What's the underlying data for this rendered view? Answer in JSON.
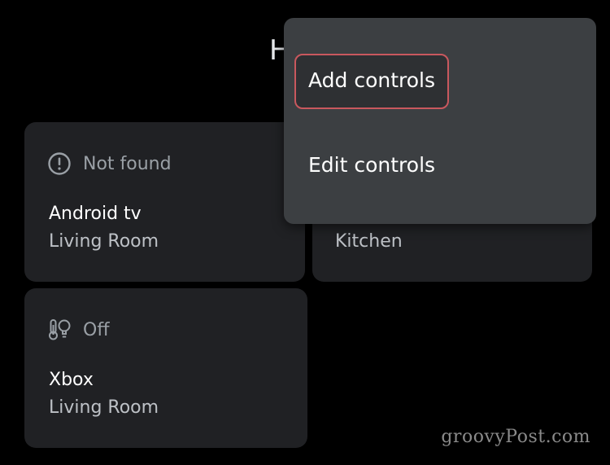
{
  "header": {
    "title_fragment": "H"
  },
  "devices": [
    {
      "status": "Not found",
      "status_icon": "alert-circle-icon",
      "name": "Android tv",
      "room": "Living Room"
    },
    {
      "status": "",
      "status_icon": "",
      "name": "",
      "room": "Kitchen"
    },
    {
      "status": "Off",
      "status_icon": "thermostat-bulb-icon",
      "name": "Xbox",
      "room": "Living Room"
    }
  ],
  "menu": {
    "items": [
      {
        "label": "Add controls"
      },
      {
        "label": "Edit controls"
      }
    ]
  },
  "colors": {
    "background": "#000000",
    "card": "#202124",
    "menu": "#3c3f42",
    "highlight_border": "#c9585e",
    "text_primary": "#ffffff",
    "text_secondary": "#9aa0a6"
  },
  "watermark": "groovyPost.com"
}
